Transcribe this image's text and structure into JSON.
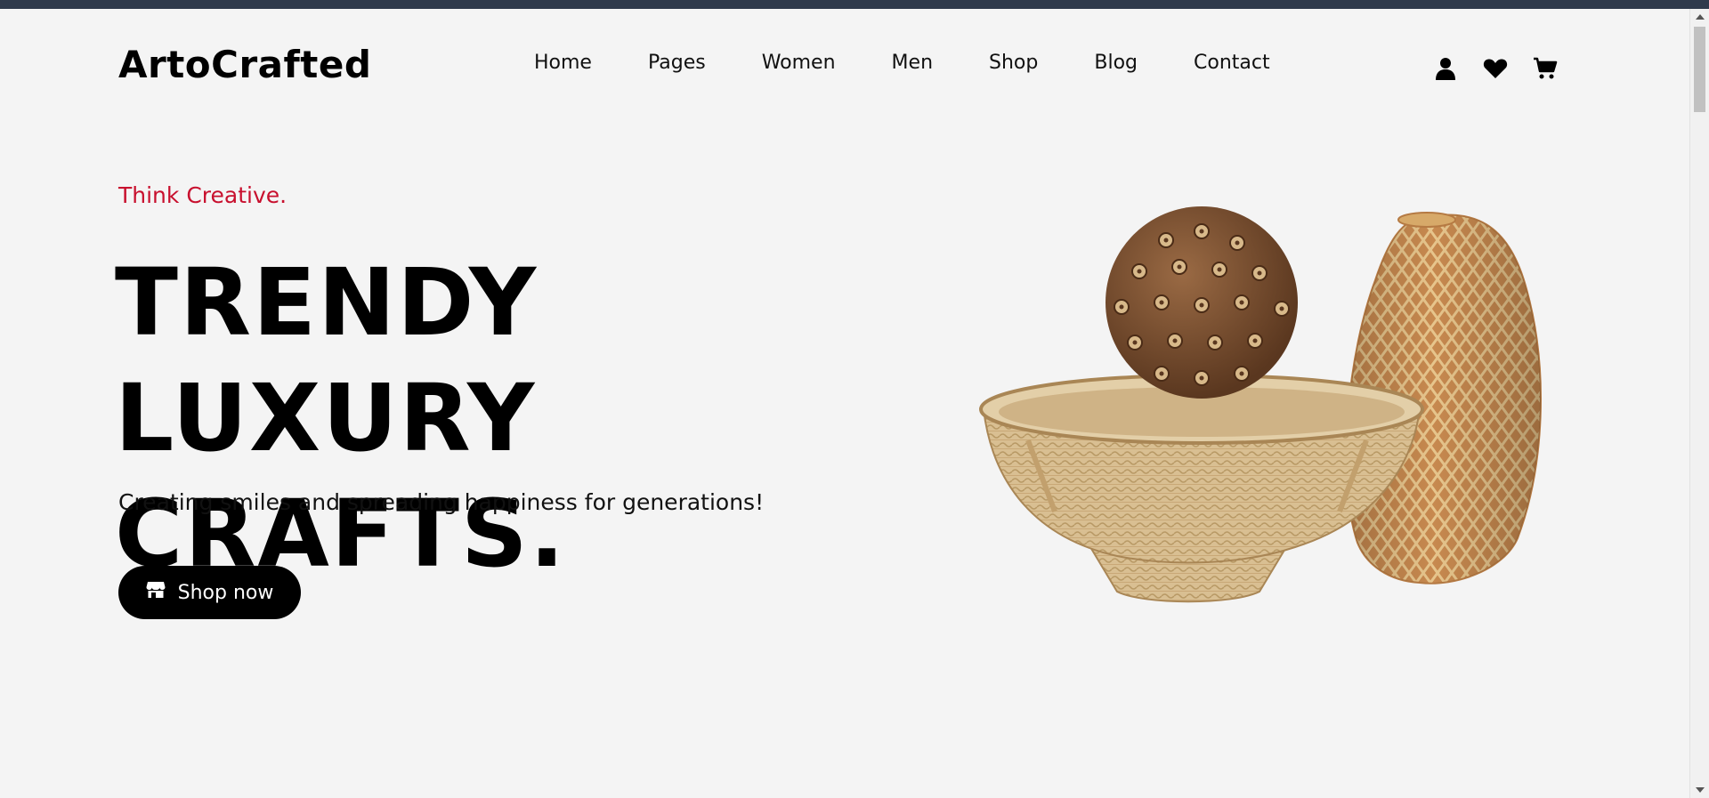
{
  "header": {
    "logo": "ArtoCrafted",
    "nav": [
      "Home",
      "Pages",
      "Women",
      "Men",
      "Shop",
      "Blog",
      "Contact"
    ],
    "icons": [
      "user-icon",
      "heart-icon",
      "cart-icon"
    ]
  },
  "hero": {
    "tagline": "Think Creative.",
    "headline_line1": "TRENDY LUXURY",
    "headline_line2": "CRAFTS.",
    "subtitle": "Creating smiles and spreading happiness for generations!",
    "cta_label": "Shop now",
    "cta_icon": "store-icon"
  },
  "colors": {
    "accent": "#c8102e",
    "button_bg": "#000000",
    "page_bg": "#f4f4f4"
  }
}
